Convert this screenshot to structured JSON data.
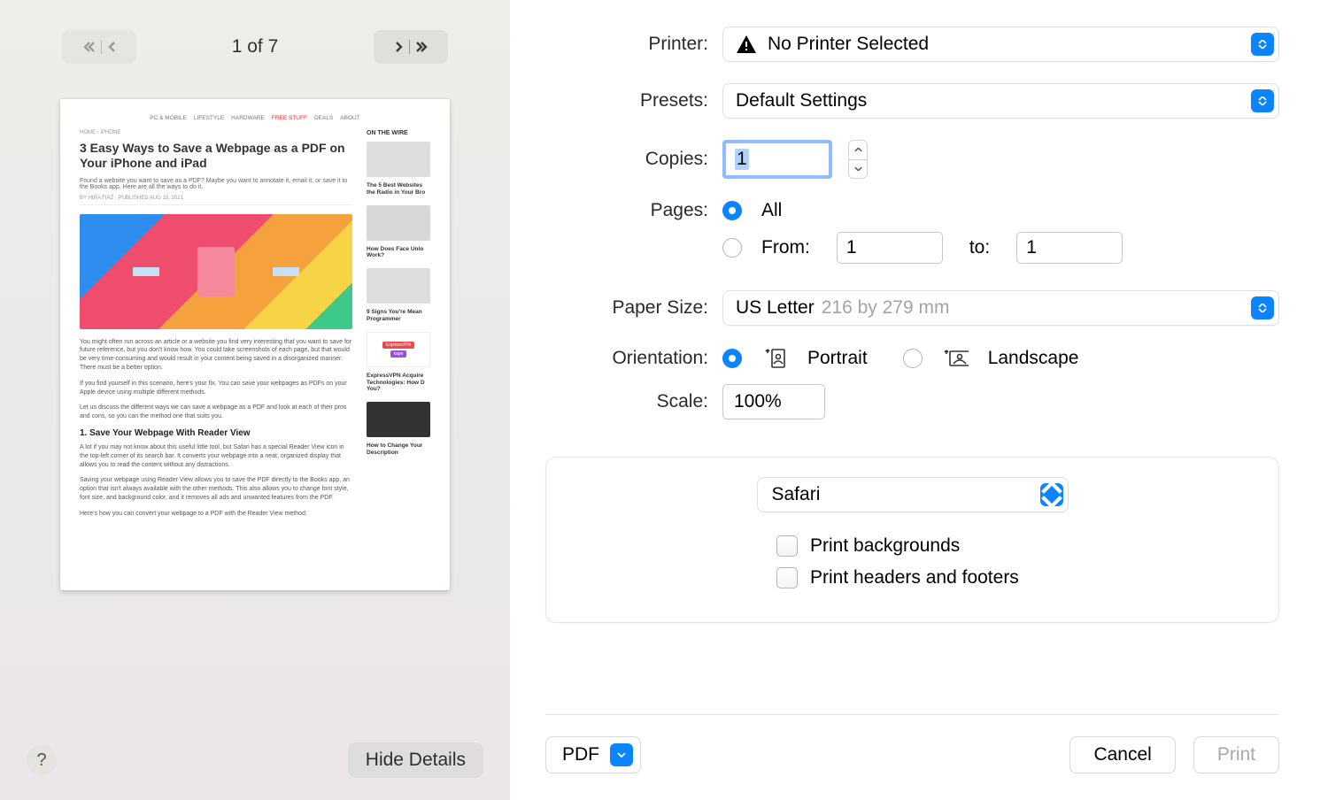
{
  "preview": {
    "page_counter": "1 of 7",
    "help_glyph": "?",
    "hide_details_label": "Hide Details",
    "thumb": {
      "topnav": [
        "PC & MOBILE",
        "LIFESTYLE",
        "HARDWARE",
        "FREE STUFF",
        "DEALS",
        "ABOUT"
      ],
      "breadcrumb": "HOME › IPHONE",
      "title": "3 Easy Ways to Save a Webpage as a PDF on Your iPhone and iPad",
      "sub": "Found a website you want to save as a PDF? Maybe you want to annotate it, email it, or save it to the Books app. Here are all the ways to do it.",
      "byline": "BY HIRA FIAZ · PUBLISHED AUG 15, 2021",
      "p1": "You might often run across an article or a website you find very interesting that you want to save for future reference, but you don't know how. You could take screenshots of each page, but that would be very time-consuming and would result in your content being saved in a disorganized manner. There must be a better option.",
      "p2": "If you find yourself in this scenario, here's your fix. You can save your webpages as PDFs on your Apple device using multiple different methods.",
      "p3": "Let us discuss the different ways we can save a webpage as a PDF and look at each of their pros and cons, so you can the method one that suits you.",
      "h2": "1. Save Your Webpage With Reader View",
      "p4": "A lot if you may not know about this useful little tool, but Safari has a special Reader View icon in the top-left corner of its search bar. It converts your webpage into a neat, organized display that allows you to read the content without any distractions.",
      "p5": "Saving your webpage using Reader View allows you to save the PDF directly to the Books app, an option that isn't always available with the other methods. This also allows you to change font style, font size, and background color, and it removes all ads and unwanted features from the PDF.",
      "p6": "Here's how you can convert your webpage to a PDF with the Reader View method:",
      "aside_label": "ON THE WIRE",
      "aside1": "The 5 Best Websites the Radio in Your Bro",
      "aside2": "How Does Face Unlo Work?",
      "aside3": "9 Signs You're Mean Programmer",
      "aside4": "ExpressVPN Acquire Technologies: How D You?",
      "aside5": "How to Change Your Description",
      "express": "ExpressVPN",
      "kape": "kape"
    }
  },
  "settings": {
    "printer_label": "Printer:",
    "printer_value": "No Printer Selected",
    "presets_label": "Presets:",
    "presets_value": "Default Settings",
    "copies_label": "Copies:",
    "copies_value": "1",
    "pages_label": "Pages:",
    "pages_all": "All",
    "pages_from_label": "From:",
    "pages_from_value": "1",
    "pages_to_label": "to:",
    "pages_to_value": "1",
    "paper_label": "Paper Size:",
    "paper_value": "US Letter",
    "paper_dim": "216 by 279 mm",
    "orient_label": "Orientation:",
    "orient_portrait": "Portrait",
    "orient_landscape": "Landscape",
    "scale_label": "Scale:",
    "scale_value": "100%",
    "app_name": "Safari",
    "checkbox1": "Print backgrounds",
    "checkbox2": "Print headers and footers"
  },
  "footer": {
    "pdf": "PDF",
    "cancel": "Cancel",
    "print": "Print"
  }
}
